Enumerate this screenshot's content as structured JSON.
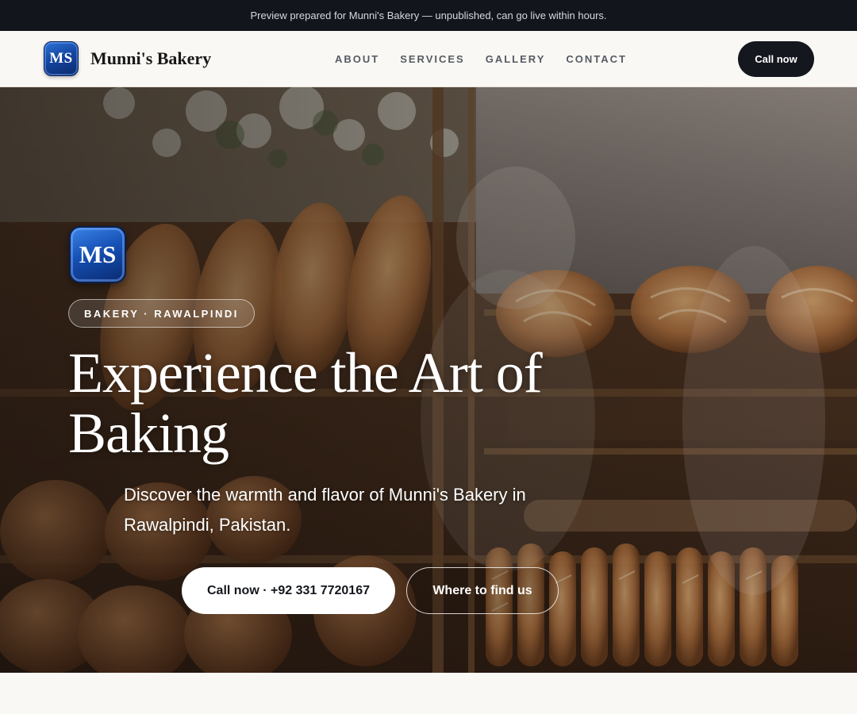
{
  "preview_banner": {
    "text": "Preview prepared for Munni's Bakery — unpublished, can go live within hours."
  },
  "header": {
    "logo_text": "MS",
    "brand_name": "Munni's Bakery",
    "nav": [
      {
        "label": "ABOUT"
      },
      {
        "label": "SERVICES"
      },
      {
        "label": "GALLERY"
      },
      {
        "label": "CONTACT"
      }
    ],
    "call_button": "Call now"
  },
  "hero": {
    "logo_text": "MS",
    "tag": "BAKERY · RAWALPINDI",
    "title": "Experience the Art of Baking",
    "subtitle": "Discover the warmth and flavor of Munni's Bakery in Rawalpindi, Pakistan.",
    "primary_button": "Call now · +92 331 7720167",
    "secondary_button": "Where to find us",
    "background": "bakery-window-photo"
  },
  "colors": {
    "banner_bg": "#12151b",
    "header_bg": "#faf8f4",
    "dark_button": "#14171d",
    "logo_blue": "#1446a3",
    "hero_text": "#ffffff"
  }
}
